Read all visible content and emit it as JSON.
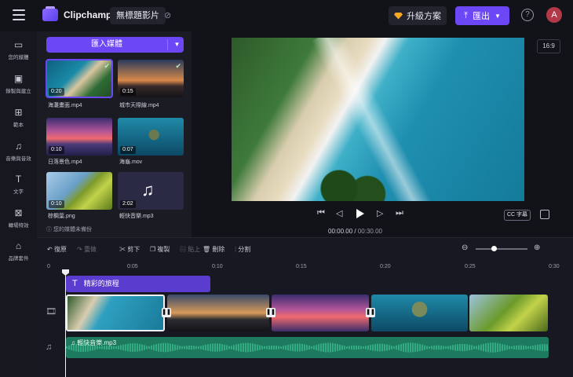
{
  "topbar": {
    "brand": "Clipchamp",
    "project_name": "無標題影片",
    "upgrade_label": "升級方案",
    "export_label": "匯出",
    "avatar_letter": "A"
  },
  "rail": [
    {
      "icon": "folder-icon",
      "label": "您的媒體"
    },
    {
      "icon": "camera-icon",
      "label": "錄製與建立"
    },
    {
      "icon": "templates-icon",
      "label": "範本"
    },
    {
      "icon": "music-icon",
      "label": "音樂與音效"
    },
    {
      "icon": "text-icon",
      "label": "文字"
    },
    {
      "icon": "transitions-icon",
      "label": "轉場特效"
    },
    {
      "icon": "brand-kit-icon",
      "label": "品牌套件"
    }
  ],
  "media": {
    "import_label": "匯入媒體",
    "items": [
      {
        "name": "海灘畫面.mp4",
        "duration": "0:20"
      },
      {
        "name": "城市天際線.mp4",
        "duration": "0:15"
      },
      {
        "name": "日落景色.mp4",
        "duration": "0:10"
      },
      {
        "name": "海龜.mov",
        "duration": "0:07"
      },
      {
        "name": "棕櫚葉.png",
        "duration": "0:10"
      },
      {
        "name": "輕快音樂.mp3",
        "duration": "2:02"
      }
    ],
    "backup_note": "您的媒體未備份"
  },
  "preview": {
    "aspect_ratio": "16:9",
    "cc_label": "CC 字幕",
    "current_time": "00:00.00",
    "total_time": "00:30.00"
  },
  "toolbar": {
    "undo": "復原",
    "redo": "重做",
    "cut": "剪下",
    "copy": "複製",
    "paste": "貼上",
    "delete": "刪除",
    "split": "分割"
  },
  "ruler": [
    "0",
    "0:05",
    "0:10",
    "0:15",
    "0:20",
    "0:25",
    "0:30"
  ],
  "timeline": {
    "text_clip": "精彩的旅程",
    "audio_clip": "輕快音樂.mp3"
  },
  "colors": {
    "accent": "#6b47f5",
    "audio": "#1d7a5e"
  }
}
